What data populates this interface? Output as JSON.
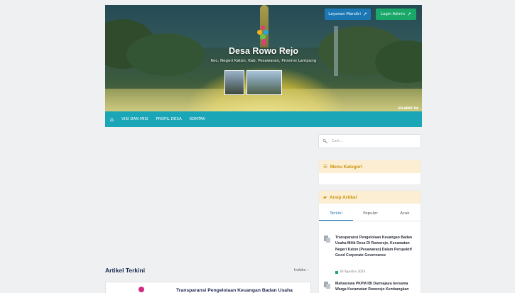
{
  "header": {
    "layanan_label": "Layanan Mandiri",
    "admin_label": "Login Admin",
    "site_title": "Desa Rowo Rejo",
    "site_subtitle": "Kec. Negeri Katon, Kab. Pesawaran, Provinsi Lampung",
    "caption": "SELAMAT DA"
  },
  "nav": {
    "items": [
      "VISI DAN MISI",
      "PROFIL DESA",
      "KONTAK"
    ]
  },
  "main": {
    "section_title": "Artikel Terkini",
    "indeks_label": "Indeks",
    "first_article_title": "Transparansi Pengelolaan Keuangan Badan Usaha"
  },
  "sidebar": {
    "search_placeholder": "Cari...",
    "kategori_title": "Menu Kategori",
    "arsip_title": "Arsip Artikel",
    "tabs": [
      "Terkini",
      "Populer",
      "Acak"
    ],
    "posts": [
      {
        "title": "Transparansi Pengelolaan Keuangan Badan Usaha Milik Desa Di Roworejo, Kecamatan Negeri Katon (Pesawaran) Dalam Perspektif Good Corporate Governance",
        "date": "30 Agustus 2023"
      },
      {
        "title": "Mahasiswa PKPM IBI Darmajaya bersama Warga Kecamatan Rowerejo Kembangkan Potensi Desa",
        "date": ""
      }
    ]
  },
  "colors": {
    "nav_bg": "#1aa6b7",
    "btn_layanan": "#1b78b5",
    "btn_admin": "#1aa86a",
    "widget_head": "#fbeed2",
    "widget_head_text": "#c99410"
  }
}
